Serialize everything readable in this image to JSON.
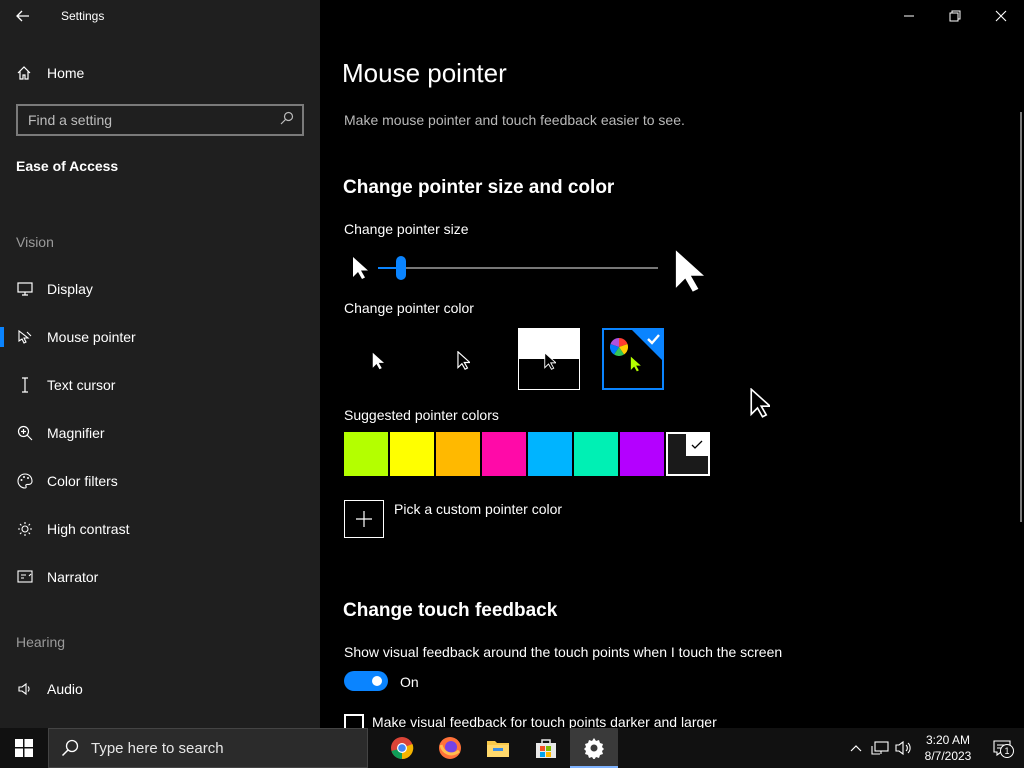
{
  "window": {
    "title": "Settings"
  },
  "sidebar": {
    "home": "Home",
    "search_placeholder": "Find a setting",
    "section": "Ease of Access",
    "groups": [
      {
        "label": "Vision",
        "items": [
          {
            "label": "Display",
            "icon": "monitor-icon"
          },
          {
            "label": "Mouse pointer",
            "icon": "mouse-pointer-icon",
            "selected": true
          },
          {
            "label": "Text cursor",
            "icon": "text-cursor-icon"
          },
          {
            "label": "Magnifier",
            "icon": "magnifier-icon"
          },
          {
            "label": "Color filters",
            "icon": "palette-icon"
          },
          {
            "label": "High contrast",
            "icon": "sun-icon"
          },
          {
            "label": "Narrator",
            "icon": "narrator-icon"
          }
        ]
      },
      {
        "label": "Hearing",
        "items": [
          {
            "label": "Audio",
            "icon": "speaker-icon"
          }
        ]
      }
    ]
  },
  "main": {
    "title": "Mouse pointer",
    "description": "Make mouse pointer and touch feedback easier to see.",
    "size_color": {
      "heading": "Change pointer size and color",
      "size_label": "Change pointer size",
      "size_value": 1,
      "color_label": "Change pointer color",
      "color_options": [
        "white",
        "black",
        "inverted",
        "custom"
      ],
      "selected_color_option": "custom",
      "suggested_label": "Suggested pointer colors",
      "suggested_colors": [
        "#b4ff00",
        "#ffff00",
        "#ffb900",
        "#ff0aa8",
        "#00b4ff",
        "#00f0b4",
        "#b400ff"
      ],
      "custom_color_label": "Pick a custom pointer color"
    },
    "touch": {
      "heading": "Change touch feedback",
      "feedback_label": "Show visual feedback around the touch points when I touch the screen",
      "toggle_state": "On",
      "darker_label": "Make visual feedback for touch points darker and larger"
    }
  },
  "taskbar": {
    "search_placeholder": "Type here to search",
    "apps": [
      "chrome-icon",
      "firefox-icon",
      "file-explorer-icon",
      "store-icon",
      "settings-icon"
    ],
    "time": "3:20 AM",
    "date": "8/7/2023",
    "notification_count": "1"
  }
}
